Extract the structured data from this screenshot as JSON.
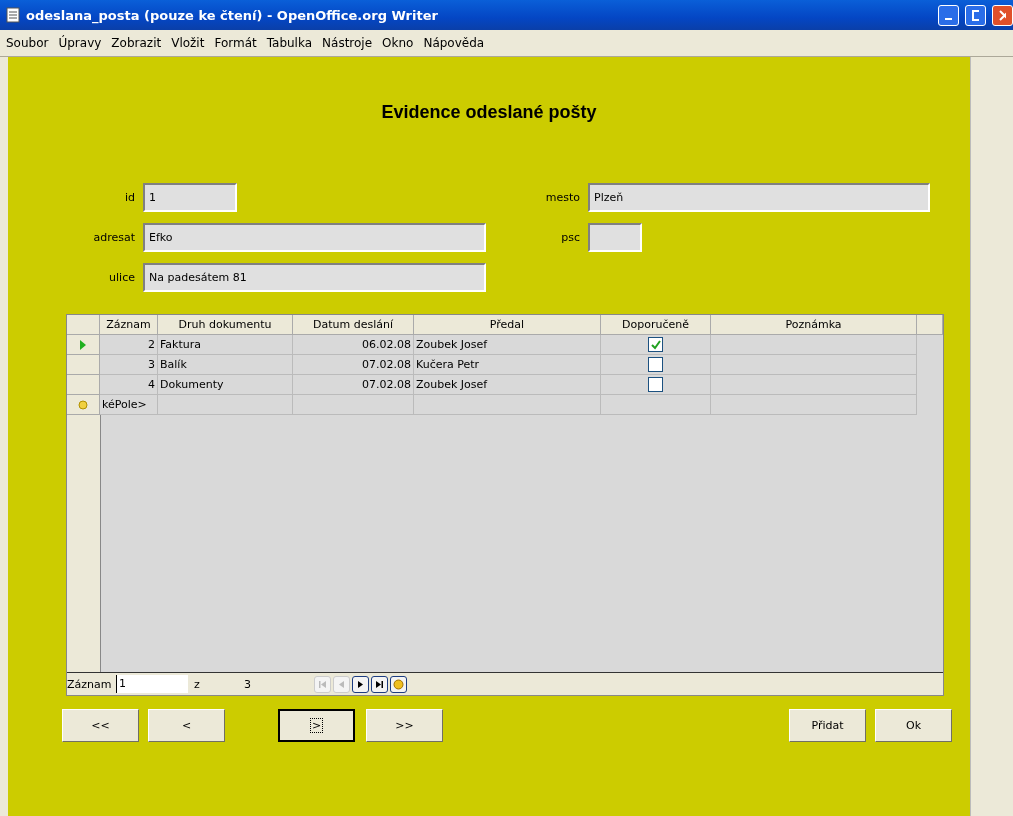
{
  "window": {
    "title": "odeslana_posta (pouze ke čtení) - OpenOffice.org Writer"
  },
  "menu": [
    "Soubor",
    "Úpravy",
    "Zobrazit",
    "Vložit",
    "Formát",
    "Tabulka",
    "Nástroje",
    "Okno",
    "Nápověda"
  ],
  "heading": "Evidence odeslané pošty",
  "fields_left": [
    {
      "label": "id",
      "value": "1",
      "kind": "small"
    },
    {
      "label": "adresat",
      "value": "Efko",
      "kind": "large"
    },
    {
      "label": "ulice",
      "value": "Na padesátem 81",
      "kind": "large"
    }
  ],
  "fields_right": [
    {
      "label": "mesto",
      "value": "Plzeň",
      "kind": "wide"
    },
    {
      "label": "psc",
      "kind": "tiny"
    }
  ],
  "table": {
    "columns": [
      "Záznam",
      "Druh dokumentu",
      "Datum deslání",
      "Předal",
      "Doporučeně",
      "Poznámka"
    ],
    "rows": [
      {
        "current": true,
        "cells": [
          "2",
          "Faktura",
          "06.02.08",
          "Zoubek Josef"
        ],
        "checked": true
      },
      {
        "current": false,
        "cells": [
          "3",
          "Balík",
          "07.02.08",
          "Kučera Petr"
        ],
        "checked": false
      },
      {
        "current": false,
        "cells": [
          "4",
          "Dokumenty",
          "07.02.08",
          "Zoubek Josef"
        ],
        "checked": false
      }
    ],
    "new_row": "kéPole>"
  },
  "navigator": {
    "label": "Záznam",
    "record": "1",
    "of": "z",
    "total": "3",
    "buttons": [
      {
        "kind": "first",
        "disabled": true
      },
      {
        "kind": "prev",
        "disabled": true
      },
      {
        "kind": "next",
        "disabled": false
      },
      {
        "kind": "last",
        "disabled": false
      },
      {
        "kind": "new",
        "disabled": false
      }
    ]
  },
  "buttons_left": [
    {
      "label": "<<",
      "focused": false
    },
    {
      "label": "<",
      "focused": false
    },
    {
      "label": ">",
      "focused": true
    },
    {
      "label": ">>",
      "focused": false
    }
  ],
  "buttons_right": [
    "Přidat",
    "Ok"
  ]
}
